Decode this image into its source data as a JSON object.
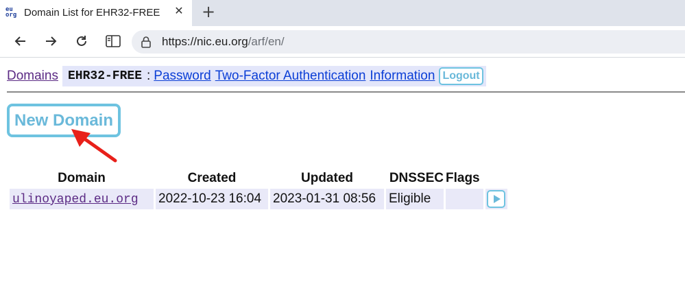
{
  "browser": {
    "favicon_text": [
      "eu",
      "org"
    ],
    "tab_title": "Domain List for EHR32-FREE",
    "tab_close": "✕",
    "new_tab": "+",
    "url_host": "https://nic.eu.org",
    "url_path": "/arf/en/"
  },
  "nav": {
    "domains_link": "Domains",
    "handle": "EHR32-FREE",
    "separator": ":",
    "password_link": "Password",
    "twofactor_link": "Two-Factor Authentication",
    "information_link": "Information",
    "logout_button": "Logout"
  },
  "new_domain_button": "New Domain",
  "table": {
    "headers": [
      "Domain",
      "Created",
      "Updated",
      "DNSSEC",
      "Flags"
    ],
    "rows": [
      {
        "domain": "ulinoyaped.eu.org",
        "created": "2022-10-23 16:04",
        "updated": "2023-01-31 08:56",
        "dnssec": "Eligible",
        "flags": ""
      }
    ]
  },
  "colors": {
    "accent": "#6ec3e0",
    "link": "#0b3ed6",
    "visited": "#5b2a84",
    "annotation_arrow": "#e8201a"
  }
}
